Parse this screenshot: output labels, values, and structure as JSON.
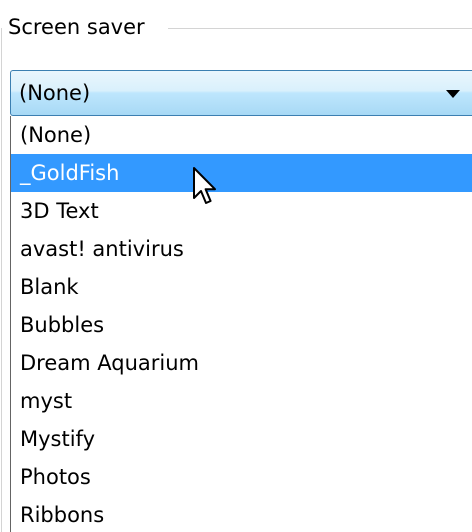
{
  "group": {
    "title": "Screen saver"
  },
  "combo": {
    "selected_value": "(None)",
    "arrow_icon": "chevron-down-icon"
  },
  "dropdown": {
    "highlighted_index": 1,
    "highlight_color": "#3399ff",
    "items": [
      {
        "label": "(None)"
      },
      {
        "label": "_GoldFish"
      },
      {
        "label": "3D Text"
      },
      {
        "label": "avast! antivirus"
      },
      {
        "label": "Blank"
      },
      {
        "label": "Bubbles"
      },
      {
        "label": "Dream Aquarium"
      },
      {
        "label": "myst"
      },
      {
        "label": "Mystify"
      },
      {
        "label": "Photos"
      },
      {
        "label": "Ribbons"
      }
    ]
  },
  "pointer": {
    "icon": "mouse-pointer-icon"
  }
}
